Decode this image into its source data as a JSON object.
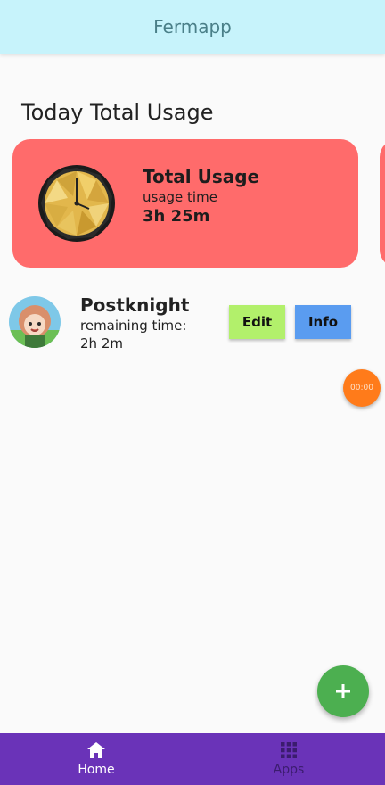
{
  "appbar": {
    "title": "Fermapp"
  },
  "section": {
    "title": "Today Total Usage"
  },
  "usage_card": {
    "title": "Total Usage",
    "subtitle": "usage time",
    "value": "3h 25m"
  },
  "app_item": {
    "name": "Postknight",
    "subtitle": "remaining time:",
    "time": "2h 2m",
    "edit_label": "Edit",
    "info_label": "Info"
  },
  "timer": {
    "text": "00:00"
  },
  "fab": {
    "icon": "plus-icon"
  },
  "bottom_nav": {
    "items": [
      {
        "label": "Home",
        "icon": "home-icon",
        "active": true
      },
      {
        "label": "Apps",
        "icon": "apps-grid-icon",
        "active": false
      }
    ]
  },
  "colors": {
    "appbar": "#c7f3fb",
    "card": "#ff6b6b",
    "edit": "#b2f06b",
    "info": "#5a9cf0",
    "fab": "#4caf50",
    "timer": "#ff7b1a",
    "nav": "#6a33b8"
  }
}
